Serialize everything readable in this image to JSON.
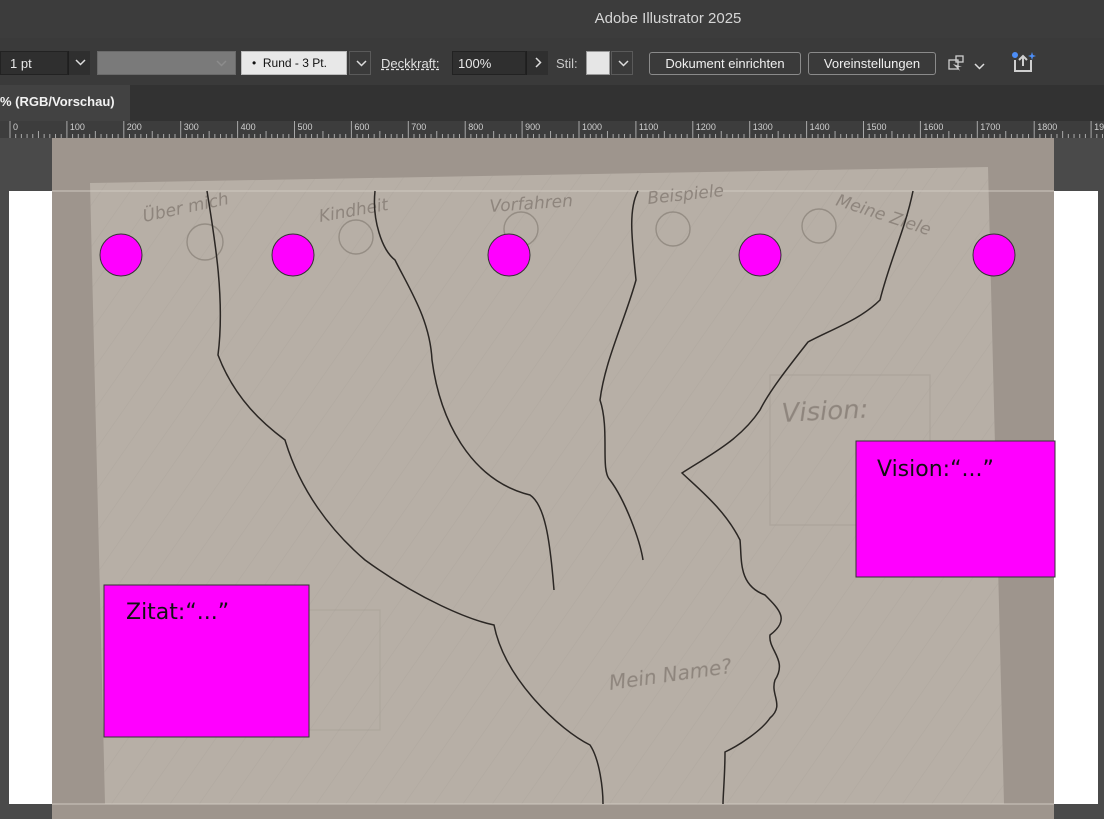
{
  "app": {
    "title": "Adobe Illustrator 2025"
  },
  "control_bar": {
    "stroke_weight": "1 pt",
    "brush": "Rund - 3 Pt.",
    "opacity_label": "Deckkraft:",
    "opacity_value": "100%",
    "style_label": "Stil:",
    "document_setup_button": "Dokument einrichten",
    "preferences_button": "Voreinstellungen"
  },
  "document_tab": {
    "label": "% (RGB/Vorschau)"
  },
  "ruler": {
    "ticks": [
      "0",
      "100",
      "200",
      "300",
      "400",
      "500",
      "600",
      "700",
      "800",
      "900",
      "1000",
      "1100",
      "1200",
      "1300",
      "1400",
      "1500",
      "1600",
      "1700",
      "1800",
      "190"
    ]
  },
  "artwork": {
    "text_frames": [
      {
        "text": "Vision:“...”"
      },
      {
        "text": "Zitat:“...”"
      }
    ],
    "sketch_labels": [
      "Über mich",
      "Kindheit",
      "Vorfahren",
      "Beispiele",
      "Meine Ziele",
      "Vision:",
      "Mein Name?"
    ],
    "accent_color": "#ff00ff"
  }
}
